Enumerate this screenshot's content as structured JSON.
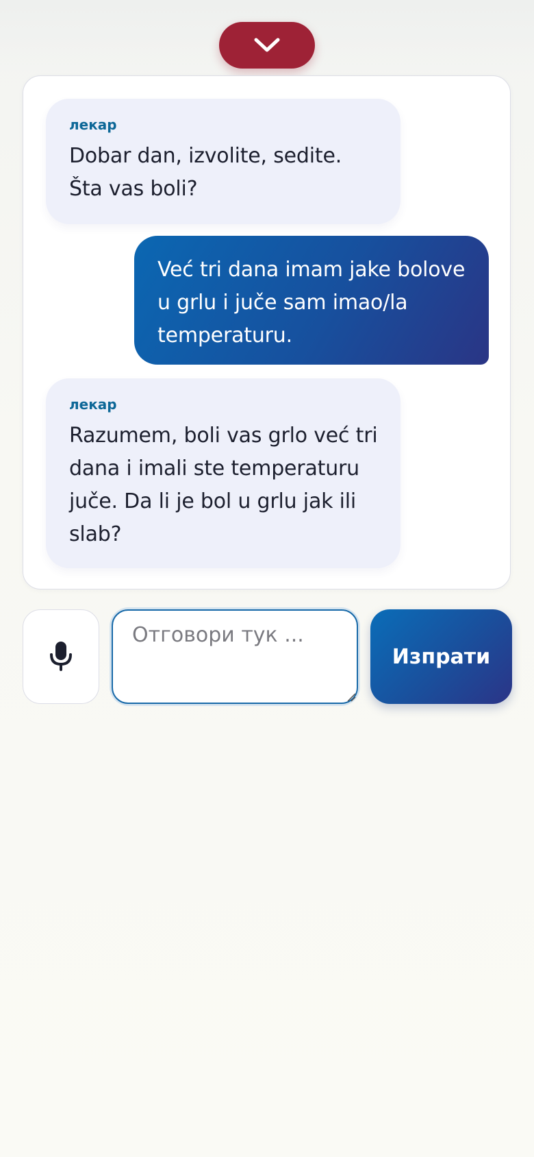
{
  "header": {
    "collapse_icon": "chevron-down-icon"
  },
  "chat": {
    "messages": [
      {
        "role": "doctor",
        "speaker": "лекар",
        "text": "Dobar dan, izvolite, sedite. Šta vas boli?"
      },
      {
        "role": "user",
        "text": "Već tri dana imam jake bolove u grlu i juče sam imao/la temperaturu."
      },
      {
        "role": "doctor",
        "speaker": "лекар",
        "text": "Razumem, boli vas grlo već tri dana i imali ste temperaturu juče. Da li je bol u grlu jak ili slab?"
      }
    ]
  },
  "composer": {
    "mic_icon": "microphone-icon",
    "placeholder": "Отговори тук ...",
    "value": "",
    "send_label": "Изпрати"
  },
  "colors": {
    "accent_red": "#9e2236",
    "accent_blue": "#0b67b2",
    "accent_indigo": "#2a3585",
    "doctor_bubble": "#eef0fa",
    "speaker_label": "#0c6797"
  }
}
